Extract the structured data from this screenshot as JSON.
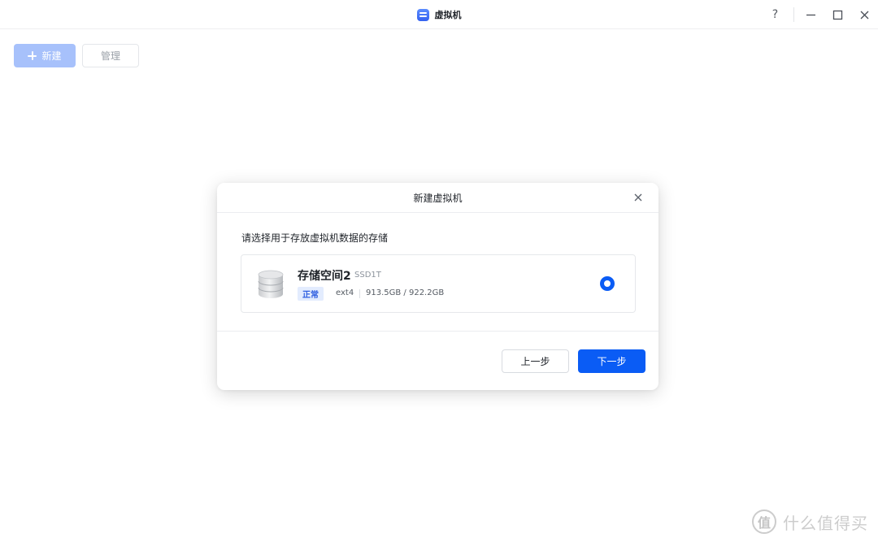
{
  "window": {
    "title": "虚拟机",
    "help_label": "?"
  },
  "toolbar": {
    "new_label": "新建",
    "manage_label": "管理"
  },
  "dialog": {
    "title": "新建虚拟机",
    "prompt": "请选择用于存放虚拟机数据的存储",
    "storage": {
      "name": "存储空间2",
      "subtitle": "SSD1T",
      "status": "正常",
      "filesystem": "ext4",
      "capacity": "913.5GB / 922.2GB",
      "selected": true
    },
    "prev_label": "上一步",
    "next_label": "下一步"
  },
  "watermark": {
    "logo_glyph": "值",
    "text": "什么值得买"
  },
  "colors": {
    "accent": "#0a5cf5",
    "new_button_disabled": "#a7c1fb",
    "badge_bg": "#e3ecfe",
    "badge_text": "#2f5fe0"
  },
  "icons": {
    "app": "virtual-machine-icon",
    "storage": "database-icon",
    "close": "close-icon",
    "plus": "plus-icon"
  }
}
